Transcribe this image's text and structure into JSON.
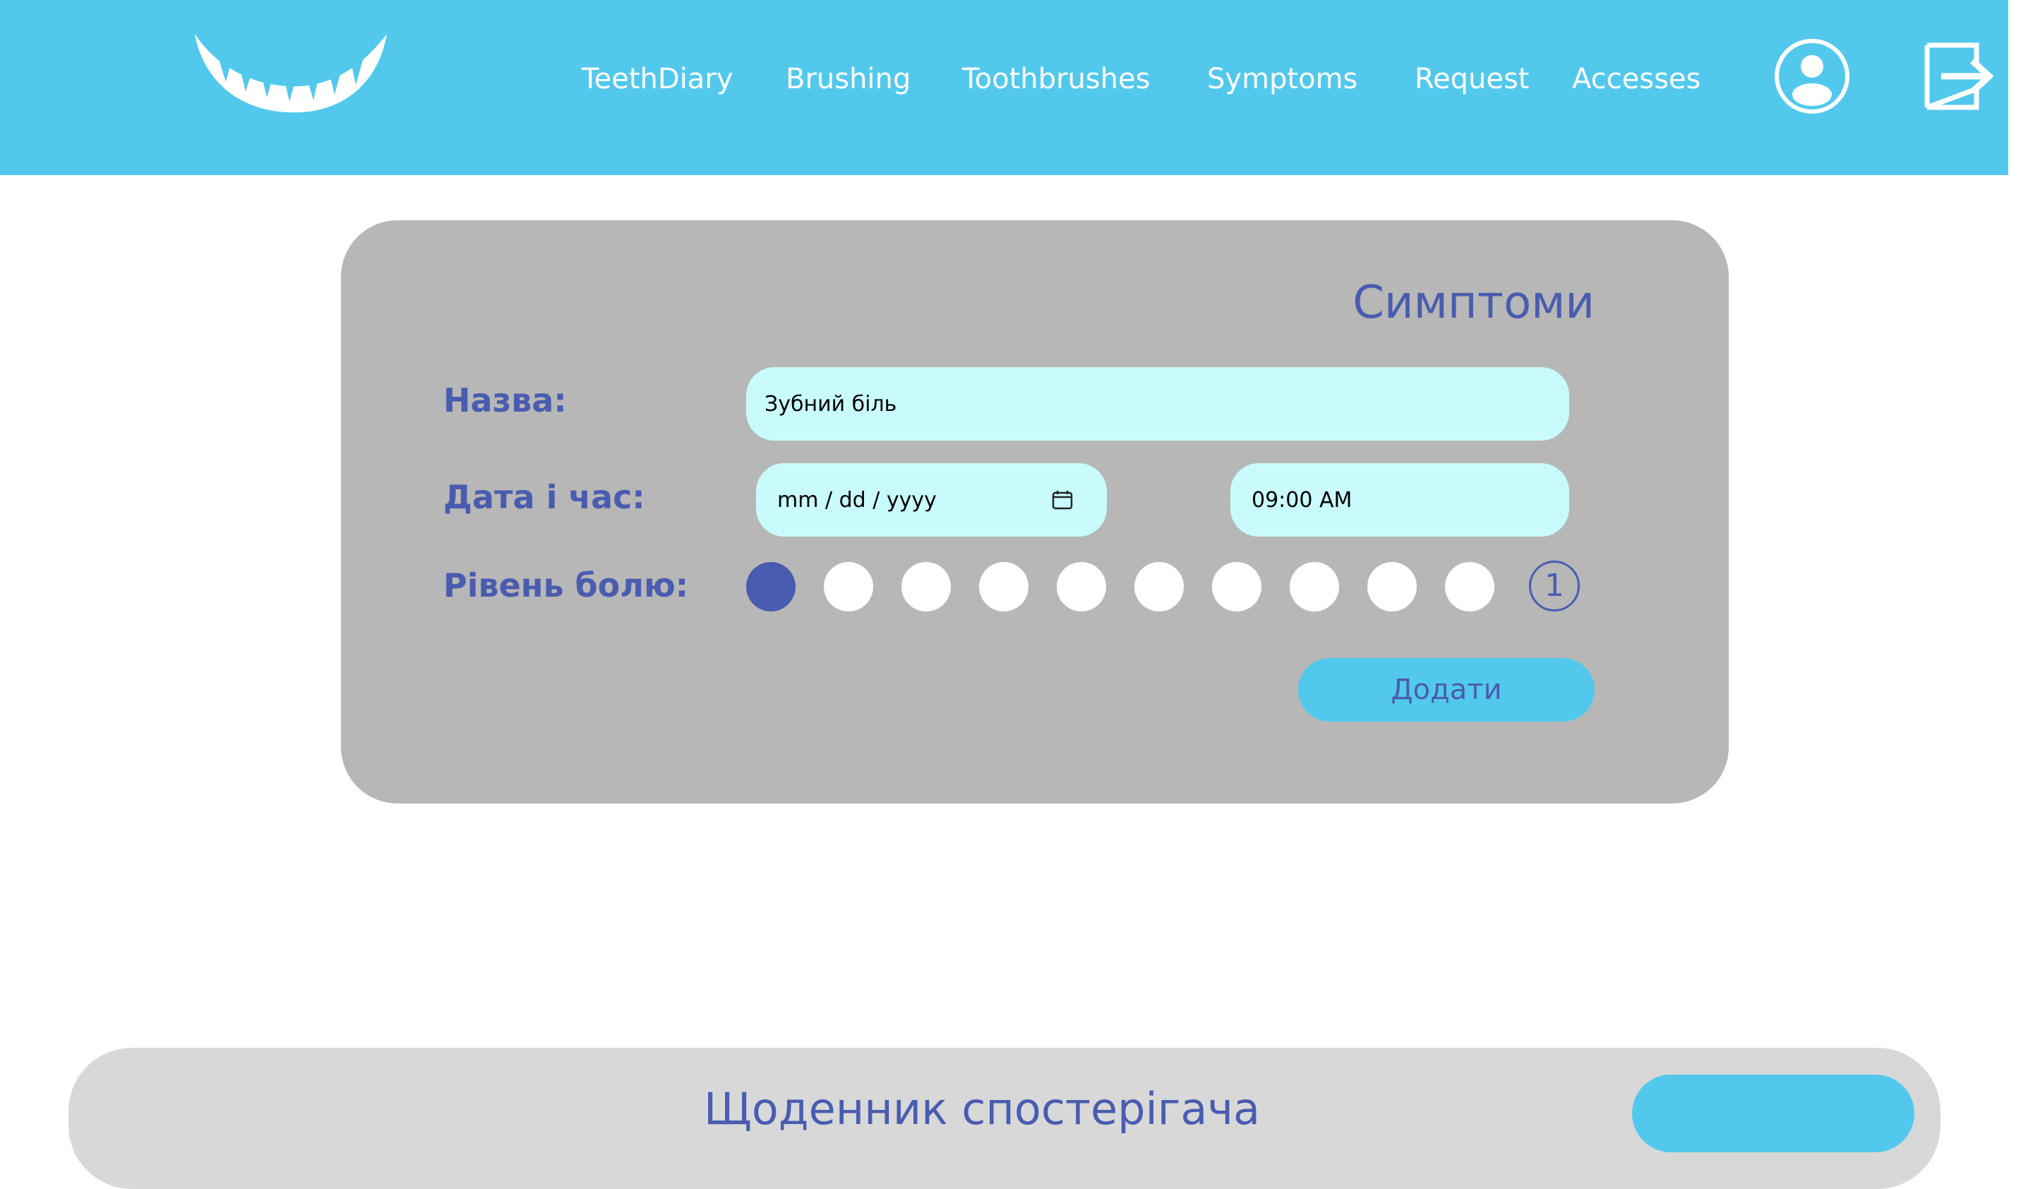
{
  "header": {
    "nav": [
      "TeethDiary",
      "Brushing",
      "Toothbrushes",
      "Symptoms",
      "Request",
      "Accesses"
    ],
    "icons": {
      "profile": "user-profile-icon",
      "logout": "logout-icon",
      "logo": "teeth-logo"
    }
  },
  "form": {
    "title": "Симптоми",
    "labels": {
      "name": "Назва:",
      "datetime": "Дата і час:",
      "pain": "Рівень болю:"
    },
    "name_value": "Зубний біль",
    "date_placeholder": "mm / dd / yyyy",
    "time_value": "09:00  AM",
    "pain_level": {
      "selected": 1,
      "max_label": "1",
      "count": 11
    },
    "submit_label": "Додати"
  },
  "bottom": {
    "title": "Щоденник спостерігача",
    "button_label": ""
  },
  "colors": {
    "header_bg": "#52c9ec",
    "panel_bg": "#b6b7b6",
    "accent_text": "#4a5cb0",
    "input_bg": "#c9fbfc"
  }
}
